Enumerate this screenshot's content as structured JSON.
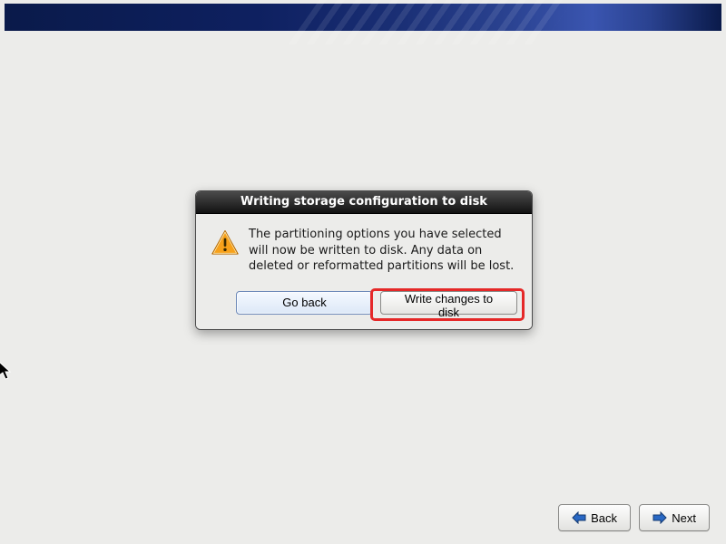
{
  "dialog": {
    "title": "Writing storage configuration to disk",
    "message": "The partitioning options you have selected will now be written to disk.  Any data on deleted or reformatted partitions will be lost.",
    "go_back_label": "Go back",
    "write_label": "Write changes to disk"
  },
  "nav": {
    "back_label": "Back",
    "next_label": "Next"
  }
}
